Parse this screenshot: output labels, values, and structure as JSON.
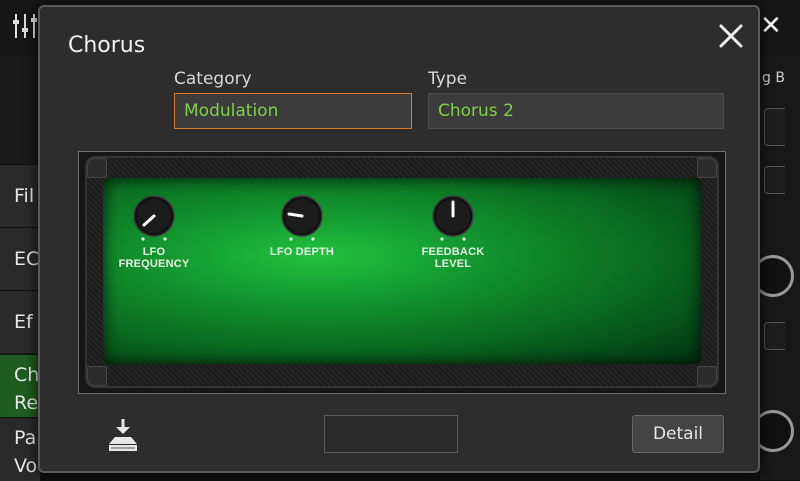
{
  "background": {
    "left_items": [
      {
        "label": "Fil",
        "active": false
      },
      {
        "label": "EC",
        "active": false
      },
      {
        "label": "Ef",
        "active": false
      },
      {
        "label": "Ch\nRe",
        "active": true
      },
      {
        "label": "Pa\nVo",
        "active": false
      }
    ],
    "right_label": "g B"
  },
  "dialog": {
    "title": "Chorus",
    "category_label": "Category",
    "category_value": "Modulation",
    "type_label": "Type",
    "type_value": "Chorus 2",
    "knobs": [
      {
        "label": "LFO\nFREQUENCY",
        "icon": "knob-icon"
      },
      {
        "label": "LFO  DEPTH",
        "icon": "knob-icon"
      },
      {
        "label": "FEEDBACK\nLEVEL",
        "icon": "knob-icon"
      }
    ],
    "mid_field_value": "",
    "detail_label": "Detail"
  },
  "colors": {
    "accent_green": "#7fd14a",
    "category_border": "#d77a2a",
    "active_item": "#1f5c1f"
  }
}
